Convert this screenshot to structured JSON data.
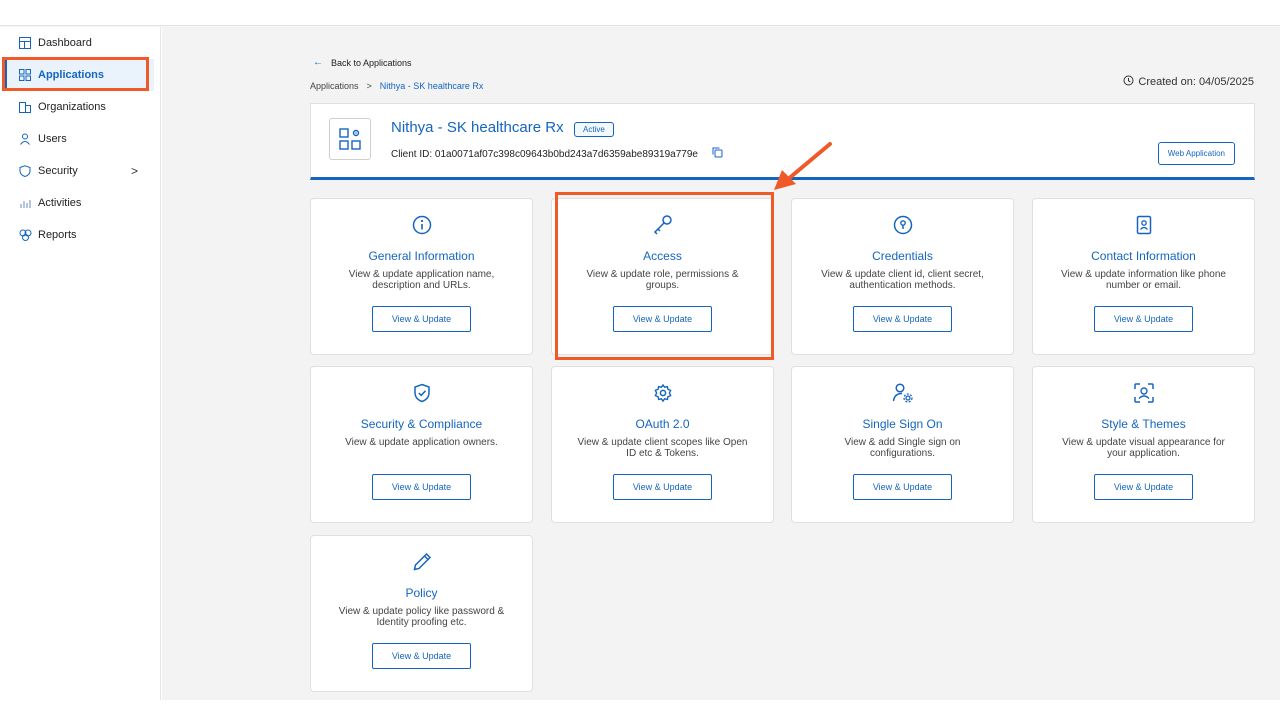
{
  "sidebar": {
    "items": [
      {
        "label": "Dashboard",
        "icon": "dashboard-icon"
      },
      {
        "label": "Applications",
        "icon": "applications-icon",
        "active": true
      },
      {
        "label": "Organizations",
        "icon": "organizations-icon"
      },
      {
        "label": "Users",
        "icon": "user-icon"
      },
      {
        "label": "Security",
        "icon": "shield-icon",
        "chevron": ">"
      },
      {
        "label": "Activities",
        "icon": "activities-icon"
      },
      {
        "label": "Reports",
        "icon": "reports-icon"
      }
    ]
  },
  "nav": {
    "back_label": "Back to Applications",
    "breadcrumb": {
      "root": "Applications",
      "separator": ">",
      "current": "Nithya - SK healthcare Rx"
    },
    "created": "Created on: 04/05/2025"
  },
  "app": {
    "name": "Nithya - SK healthcare Rx",
    "status": "Active",
    "client_id": "Client ID: 01a0071af07c398c09643b0bd243a7d6359abe89319a779e",
    "type": "Web Application"
  },
  "cards": [
    {
      "title": "General Information",
      "desc": "View & update application name, description and URLs.",
      "button": "View & Update",
      "icon": "info-icon"
    },
    {
      "title": "Access",
      "desc": "View & update role, permissions & groups.",
      "button": "View & Update",
      "icon": "key-icon"
    },
    {
      "title": "Credentials",
      "desc": "View & update client id, client secret, authentication methods.",
      "button": "View & Update",
      "icon": "lock-circle-icon"
    },
    {
      "title": "Contact Information",
      "desc": "View & update information like phone number or email.",
      "button": "View & Update",
      "icon": "contact-book-icon"
    },
    {
      "title": "Security & Compliance",
      "desc": "View & update application owners.",
      "button": "View & Update",
      "icon": "shield-check-icon"
    },
    {
      "title": "OAuth 2.0",
      "desc": "View & update client scopes like Open ID etc & Tokens.",
      "button": "View & Update",
      "icon": "gear-icon"
    },
    {
      "title": "Single Sign On",
      "desc": "View & add Single sign on configurations.",
      "button": "View & Update",
      "icon": "user-gear-icon"
    },
    {
      "title": "Style & Themes",
      "desc": "View & update visual appearance for your application.",
      "button": "View & Update",
      "icon": "face-scan-icon"
    },
    {
      "title": "Policy",
      "desc": "View & update policy like password & Identity proofing etc.",
      "button": "View & Update",
      "icon": "pencil-icon"
    }
  ],
  "colors": {
    "accent": "#1565c0",
    "highlight": "#f05a28",
    "background": "#f3f3f3"
  }
}
